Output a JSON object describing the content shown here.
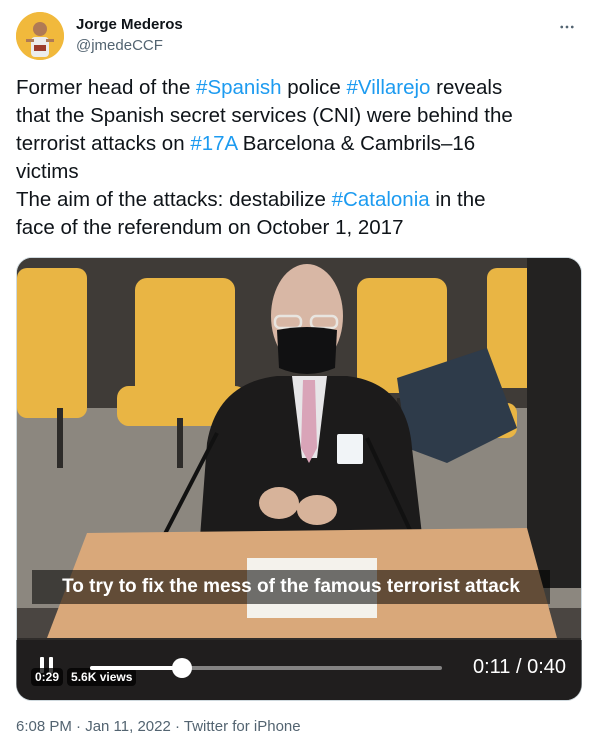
{
  "author": {
    "name": "Jorge Mederos",
    "handle": "@jmedeCCF"
  },
  "tweet": {
    "lines": [
      [
        {
          "t": "Former head of the "
        },
        {
          "t": "#Spanish",
          "tag": true
        },
        {
          "t": " police "
        },
        {
          "t": "#Villarejo",
          "tag": true
        },
        {
          "t": " reveals"
        }
      ],
      [
        {
          "t": "that the Spanish secret services (CNI) were behind the"
        }
      ],
      [
        {
          "t": "terrorist attacks on "
        },
        {
          "t": "#17A",
          "tag": true
        },
        {
          "t": " Barcelona & Cambrils–16"
        }
      ],
      [
        {
          "t": "victims"
        }
      ],
      [
        {
          "t": "The aim of the attacks: destabilize "
        },
        {
          "t": "#Catalonia",
          "tag": true
        },
        {
          "t": " in the"
        }
      ],
      [
        {
          "t": "face of the referendum on October 1, 2017"
        }
      ]
    ]
  },
  "video": {
    "subtitle": "To try to fix the mess of the famous terrorist attack",
    "elapsed_badge": "0:29",
    "views_badge": "5.6K views",
    "time_display": "0:11 / 0:40",
    "progress": 0.26
  },
  "meta": {
    "timestamp": "6:08 PM · Jan 11, 2022 · ",
    "source": "Twitter for iPhone"
  },
  "colors": {
    "link": "#1d9bf0",
    "secondary_text": "#536471"
  },
  "icons": {
    "more": "more-horizontal-icon",
    "pause": "pause-icon"
  }
}
